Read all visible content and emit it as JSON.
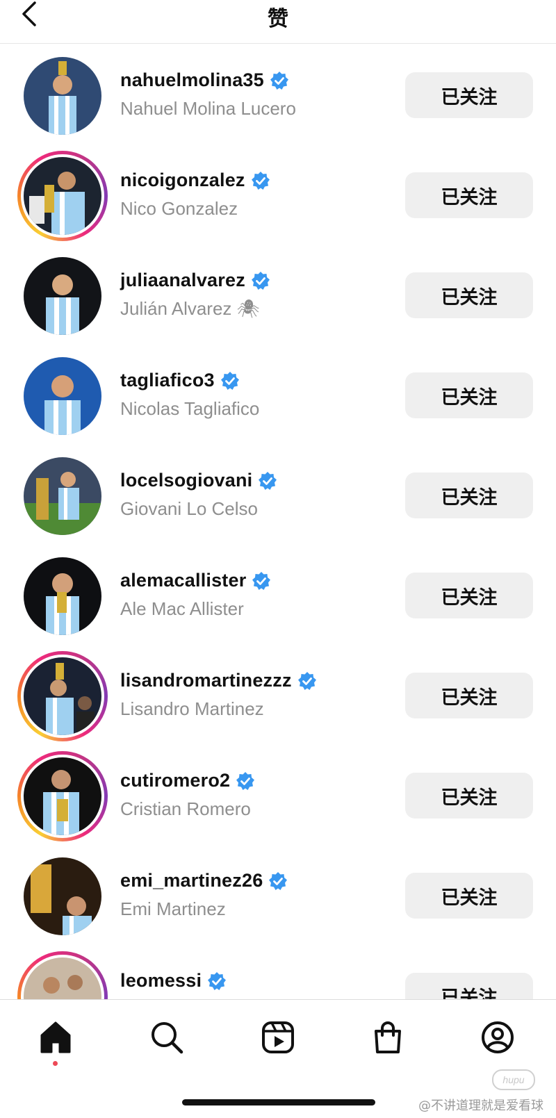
{
  "header": {
    "title": "赞"
  },
  "follow_label": "已关注",
  "rows": [
    {
      "username": "nahuelmolina35",
      "fullname": "Nahuel Molina Lucero",
      "ring": false,
      "icon": "player-photo"
    },
    {
      "username": "nicoigonzalez",
      "fullname": "Nico Gonzalez",
      "ring": true,
      "icon": "player-photo"
    },
    {
      "username": "juliaanalvarez",
      "fullname": "Julián Alvarez 🕷",
      "ring": false,
      "icon": "player-photo"
    },
    {
      "username": "tagliafico3",
      "fullname": "Nicolas Tagliafico",
      "ring": false,
      "icon": "player-photo"
    },
    {
      "username": "locelsogiovani",
      "fullname": "Giovani Lo Celso",
      "ring": false,
      "icon": "player-photo"
    },
    {
      "username": "alemacallister",
      "fullname": "Ale Mac Allister",
      "ring": false,
      "icon": "player-photo"
    },
    {
      "username": "lisandromartinezzz",
      "fullname": "Lisandro Martinez",
      "ring": true,
      "icon": "player-photo"
    },
    {
      "username": "cutiromero2",
      "fullname": "Cristian Romero",
      "ring": true,
      "icon": "player-photo"
    },
    {
      "username": "emi_martinez26",
      "fullname": "Emi Martinez",
      "ring": false,
      "icon": "player-photo"
    },
    {
      "username": "leomessi",
      "fullname": "",
      "ring": true,
      "icon": "player-photo"
    }
  ],
  "tabs": [
    {
      "name": "home-icon",
      "active": true
    },
    {
      "name": "search-icon",
      "active": false
    },
    {
      "name": "reels-icon",
      "active": false
    },
    {
      "name": "shop-icon",
      "active": false
    },
    {
      "name": "profile-icon",
      "active": false
    }
  ],
  "watermark": {
    "logo": "hupu",
    "text": "@不讲道理就是爱看球"
  },
  "colors": {
    "verified": "#3897f0",
    "secondary_text": "#8e8e8e",
    "button_bg": "#efefef",
    "notification_dot": "#ed4956"
  }
}
